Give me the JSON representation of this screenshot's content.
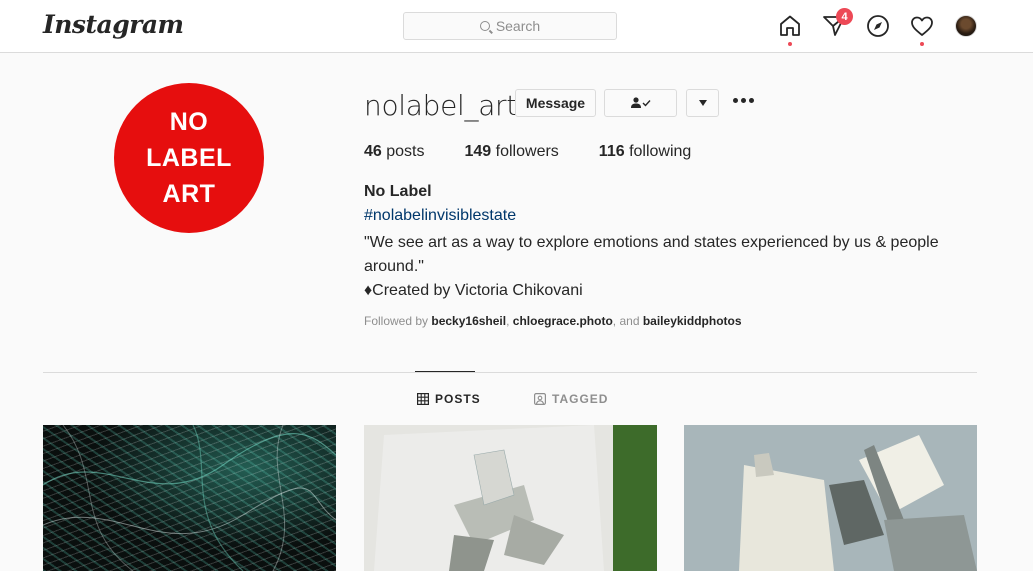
{
  "header": {
    "logo": "Instagram",
    "search_placeholder": "Search",
    "notifications_badge": "4",
    "icons": [
      "home-icon",
      "direct-icon",
      "explore-icon",
      "heart-icon",
      "avatar"
    ]
  },
  "profile": {
    "avatar_text": [
      "NO",
      "LABEL",
      "ART"
    ],
    "username": "nolabel_art",
    "message_button": "Message",
    "stats": {
      "posts_count": "46",
      "posts_label": "posts",
      "followers_count": "149",
      "followers_label": "followers",
      "following_count": "116",
      "following_label": "following"
    },
    "bio": {
      "name": "No Label",
      "hashtag": "#nolabelinvisiblestate",
      "line1": "\"We see art as a way to explore emotions and states experienced by us & people around.\"",
      "line2": "♦Created by Victoria Chikovani"
    },
    "followed_by": {
      "prefix": "Followed by",
      "user1": "becky16sheil",
      "sep": ",",
      "user2": "chloegrace.photo",
      "and": ", and",
      "user3": "baileykiddphotos"
    }
  },
  "tabs": [
    {
      "label": "POSTS",
      "active": true
    },
    {
      "label": "TAGGED",
      "active": false
    }
  ],
  "colors": {
    "avatar_red": "#e60e0e",
    "badge_red": "#ed4956",
    "link_blue": "#00376b"
  }
}
